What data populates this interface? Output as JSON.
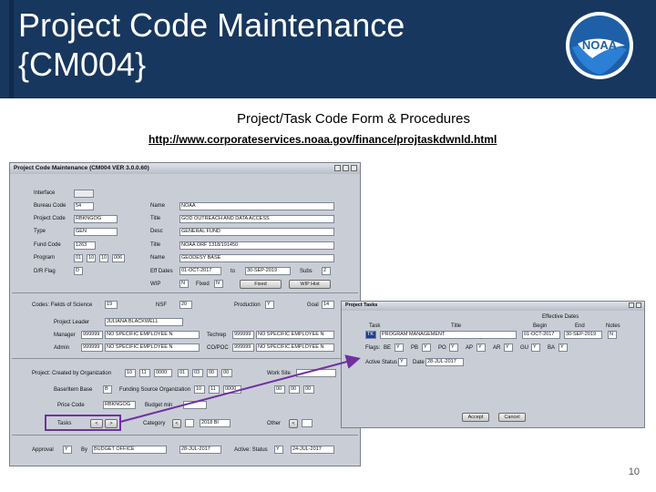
{
  "header": {
    "title": "Project Code Maintenance\n{CM004}",
    "logo_text": "NOAA"
  },
  "subtitle": "Project/Task Code Form & Procedures",
  "link": "http://www.corporateservices.noaa.gov/finance/projtaskdwnld.html",
  "page_number": "10",
  "main_window": {
    "title": "Project Code Maintenance (CM004 VER 3.0.0.60)",
    "labels": {
      "interface": "Interface",
      "bureau_code": "Bureau Code",
      "project_code": "Project Code",
      "type": "Type",
      "fund_code": "Fund Code",
      "program": "Program",
      "dr_flag": "D/R Flag",
      "name": "Name",
      "title": "Title",
      "desc": "Desc",
      "title2": "Title",
      "name2": "Name",
      "eff_dates": "Eff Dates",
      "to": "to",
      "wip": "WIP",
      "fixed": "Fixed",
      "subs": "Subs",
      "codes_fields": "Codes: Fields of Science",
      "nsf": "NSF",
      "production": "Production",
      "goal": "Goal",
      "project_leader": "Project Leader",
      "manager": "Manager",
      "admin": "Admin",
      "techrep": "Techrep",
      "cotr": "CO/POC",
      "project_created": "Project: Created by Organization",
      "work_site": "Work Site",
      "base_item_base": "Base/Item Base",
      "funding_source": "Funding Source Organization",
      "price_code": "Price Code",
      "budget_mins": "Budget min",
      "tasks": "Tasks",
      "category": "Category",
      "other": "Other",
      "approval": "Approval",
      "by": "By",
      "active_status": "Active: Status"
    },
    "values": {
      "bureau_code": "54",
      "project_code": "RBKNGOG",
      "type": "GEN",
      "fund_code": "1263",
      "program": [
        "01",
        "10",
        "10",
        "006"
      ],
      "dr_flag": "D",
      "name": "NOAA",
      "title": "GOD OUTREACH AND DATA ACCESS",
      "desc": "GENERAL FUND",
      "title2": "NOAA ORF 1318/191450",
      "name2": "GEODESY BASE",
      "eff_start": "01-OCT-2017",
      "eff_end": "30-SEP-2019",
      "subs": "2",
      "wip": "N",
      "fixed_flag": "N",
      "fixed_label": "Fixed",
      "wip_hist": "WIP Hist",
      "fields_science": "19",
      "nsf": "20",
      "production": "Y",
      "goal": "14",
      "project_leader": "JULIANA BLACKWELL",
      "manager_id": "999999",
      "manager_name": "NO SPECIFIC EMPLOYEE N",
      "admin_id": "999999",
      "admin_name": "NO SPECIFIC EMPLOYEE N",
      "techrep_id": "999999",
      "techrep_name": "NO SPECIFIC EMPLOYEE N",
      "cotr_id": "999999",
      "cotr_name": "NO SPECIFIC EMPLOYEE N",
      "org": [
        "10",
        "11",
        "0000",
        "01",
        "03",
        "00",
        "00"
      ],
      "base_item": "B",
      "funding_org": [
        "10",
        "11",
        "0000",
        "00",
        "00",
        "00"
      ],
      "price_code": "RBKNGOG",
      "category": "",
      "year": "2018 BI",
      "approval": "Y",
      "by": "BUDGET OFFICE",
      "approval_date": "28-JUL-2017",
      "active": "Y",
      "active_date": "24-JUL-2017"
    }
  },
  "tasks_window": {
    "title": "Project Tasks",
    "headers": {
      "task": "Task",
      "title": "Title",
      "effective_dates": "Effective Dates",
      "begin": "Begin",
      "end": "End",
      "notes": "Notes"
    },
    "row": {
      "task": "TK",
      "title": "PROGRAM MANAGEMENT",
      "begin": "01-OCT-2017",
      "end": "30-SEP-2019",
      "notes": "N"
    },
    "flags_label": "Flags:",
    "flags": [
      {
        "label": "BE",
        "value": "Y"
      },
      {
        "label": "PB",
        "value": "Y"
      },
      {
        "label": "PO",
        "value": "Y"
      },
      {
        "label": "AP",
        "value": "Y"
      },
      {
        "label": "AR",
        "value": "Y"
      },
      {
        "label": "GU",
        "value": "Y"
      },
      {
        "label": "BA",
        "value": "Y"
      }
    ],
    "active_status_label": "Active Status",
    "active_status": "Y",
    "date_label": "Date",
    "date": "28-JUL-2017",
    "accept_button": "Accept",
    "cancel_button": "Cancel"
  },
  "colors": {
    "header_bg": "#17375e",
    "accent": "#7030a0"
  }
}
